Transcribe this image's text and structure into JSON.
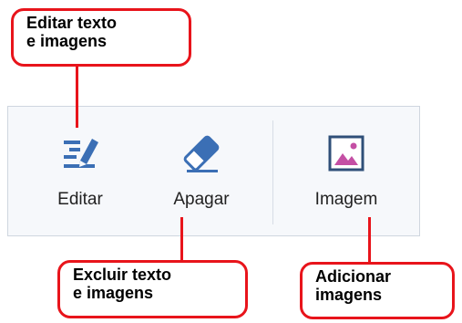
{
  "callouts": {
    "edit": "Editar texto\ne imagens",
    "erase": "Excluir texto\ne imagens",
    "image": "Adicionar\nimagens"
  },
  "toolbar": {
    "edit_label": "Editar",
    "erase_label": "Apagar",
    "image_label": "Imagem"
  },
  "icons": {
    "edit": "pencil-text-icon",
    "erase": "eraser-icon",
    "image": "image-icon"
  },
  "colors": {
    "callout_border": "#e8141b",
    "icon_blue": "#3b6fb5",
    "image_frame": "#2f4f78",
    "image_accent": "#c44fa4",
    "panel_bg": "#f6f8fb"
  }
}
